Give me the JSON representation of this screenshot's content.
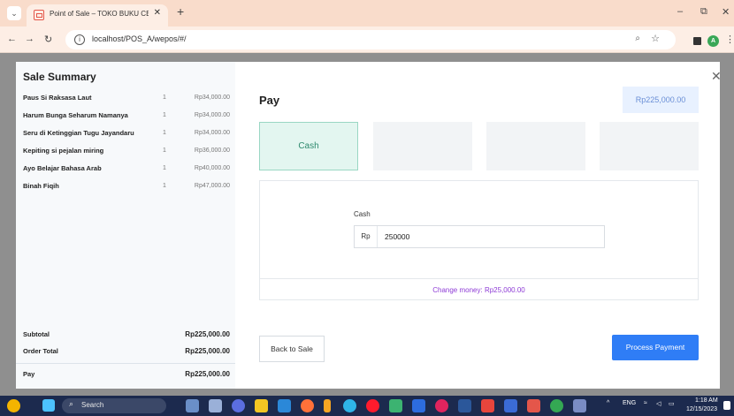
{
  "browser": {
    "tab_title": "Point of Sale – TOKO BUKU CEN",
    "tab_close": "✕",
    "new_tab": "+",
    "url": "localhost/POS_A/wepos/#/",
    "win_minimize": "–",
    "win_restore": "⧉",
    "win_close": "✕",
    "avatar_letter": "A"
  },
  "sale_summary": {
    "title": "Sale Summary",
    "items": [
      {
        "name": "Paus Si Raksasa Laut",
        "qty": "1",
        "price": "Rp34,000.00"
      },
      {
        "name": "Harum Bunga Seharum Namanya",
        "qty": "1",
        "price": "Rp34,000.00"
      },
      {
        "name": "Seru di Ketinggian Tugu Jayandaru",
        "qty": "1",
        "price": "Rp34,000.00"
      },
      {
        "name": "Kepiting si pejalan miring",
        "qty": "1",
        "price": "Rp36,000.00"
      },
      {
        "name": "Ayo Belajar Bahasa Arab",
        "qty": "1",
        "price": "Rp40,000.00"
      },
      {
        "name": "Binah Fiqih",
        "qty": "1",
        "price": "Rp47,000.00"
      }
    ],
    "subtotal_label": "Subtotal",
    "subtotal_value": "Rp225,000.00",
    "order_total_label": "Order Total",
    "order_total_value": "Rp225,000.00",
    "pay_label": "Pay",
    "pay_value": "Rp225,000.00"
  },
  "pay": {
    "heading": "Pay",
    "amount": "Rp225,000.00",
    "methods": [
      {
        "label": "Cash",
        "active": true
      },
      {
        "label": "",
        "active": false
      },
      {
        "label": "",
        "active": false
      },
      {
        "label": "",
        "active": false
      }
    ],
    "cash_label": "Cash",
    "currency_prefix": "Rp",
    "cash_value": "250000",
    "change_text": "Change money: Rp25,000.00",
    "back_button": "Back to Sale",
    "process_button": "Process Payment"
  },
  "taskbar": {
    "search_text": "Search",
    "language": "ENG",
    "time": "1:18 AM",
    "date": "12/15/2023"
  },
  "colors": {
    "tab_bar": "#f9dccb",
    "active_method": "#e3f6f0",
    "process_button": "#2f7df6",
    "change_text": "#8e3cd6",
    "taskbar": "#1c2a4e"
  }
}
